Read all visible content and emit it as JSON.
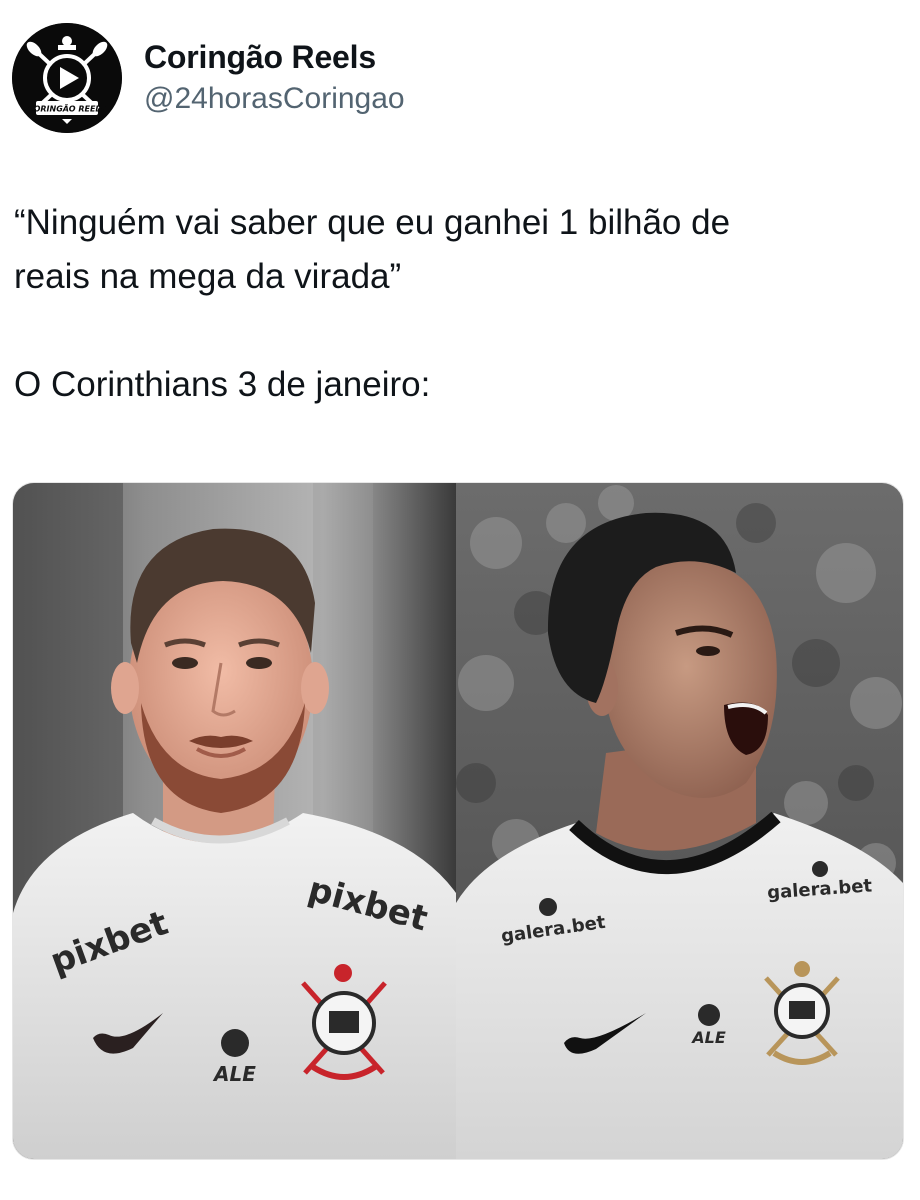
{
  "tweet": {
    "author": {
      "display_name": "Coringão Reels",
      "handle": "@24horasCoringao",
      "avatar_icon": "corinthians-reels-logo-icon",
      "avatar_text": "CORINGÃO REELS"
    },
    "text_line1": "“Ninguém vai saber que eu ganhei 1 bilhão de",
    "text_line2": "reais na mega da virada”",
    "text_line3": "O Corinthians 3 de janeiro:"
  },
  "media": {
    "left_photo": {
      "sponsor_left": "pixbet",
      "sponsor_right": "pixbet",
      "sleeve_sponsor": "ALE"
    },
    "right_photo": {
      "sponsor_left": "galera.bet",
      "sponsor_right": "galera.bet",
      "sleeve_sponsor": "ALE"
    }
  },
  "colors": {
    "text": "#0f1419",
    "secondary": "#536471",
    "crest_red": "#c8242b",
    "crest_gold": "#b8955a"
  }
}
